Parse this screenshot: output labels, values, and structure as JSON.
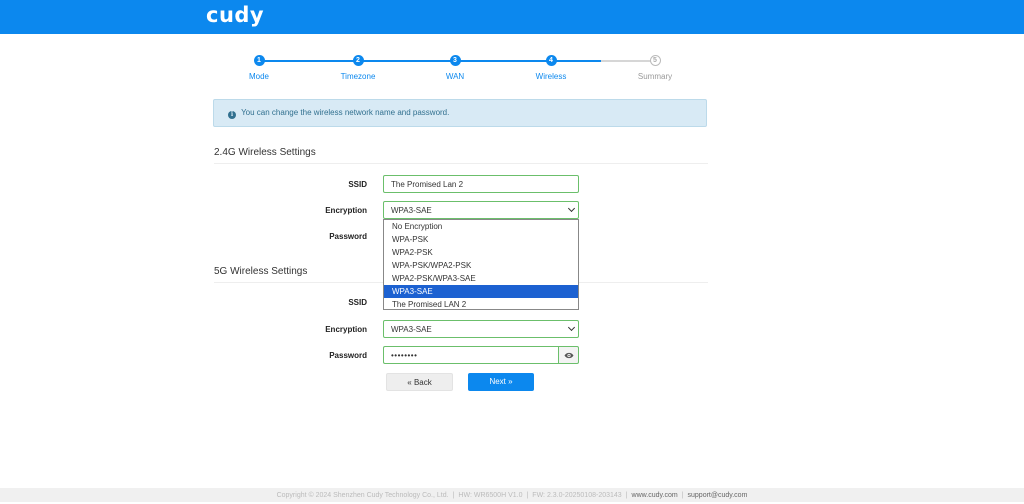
{
  "header": {
    "logo": "cudy",
    "color": "#0c88ee"
  },
  "steps": [
    {
      "num": "1",
      "label": "Mode",
      "state": "done"
    },
    {
      "num": "2",
      "label": "Timezone",
      "state": "done"
    },
    {
      "num": "3",
      "label": "WAN",
      "state": "done"
    },
    {
      "num": "4",
      "label": "Wireless",
      "state": "active"
    },
    {
      "num": "5",
      "label": "Summary",
      "state": "pending"
    }
  ],
  "info": {
    "icon": "info-icon",
    "text": "You can change the wireless network name and password."
  },
  "wifi24": {
    "title": "2.4G Wireless Settings",
    "ssid_label": "SSID",
    "ssid_value": "The Promised Lan 2",
    "encryption_label": "Encryption",
    "encryption_value": "WPA3-SAE",
    "password_label": "Password"
  },
  "dropdown": {
    "options": [
      "No Encryption",
      "WPA-PSK",
      "WPA2-PSK",
      "WPA-PSK/WPA2-PSK",
      "WPA2-PSK/WPA3-SAE",
      "WPA3-SAE",
      "The Promised LAN 2"
    ],
    "selected_index": 5
  },
  "wifi5": {
    "title": "5G Wireless Settings",
    "ssid_label": "SSID",
    "encryption_label": "Encryption",
    "encryption_value": "WPA3-SAE",
    "password_label": "Password",
    "password_value": "••••••••"
  },
  "buttons": {
    "back": "« Back",
    "next": "Next »"
  },
  "footer": {
    "copyright": "Copyright © 2024 Shenzhen Cudy Technology Co., Ltd.",
    "hw": "HW: WR6500H V1.0",
    "fw": "FW: 2.3.0-20250108-203143",
    "website": "www.cudy.com",
    "support": "support@cudy.com"
  }
}
